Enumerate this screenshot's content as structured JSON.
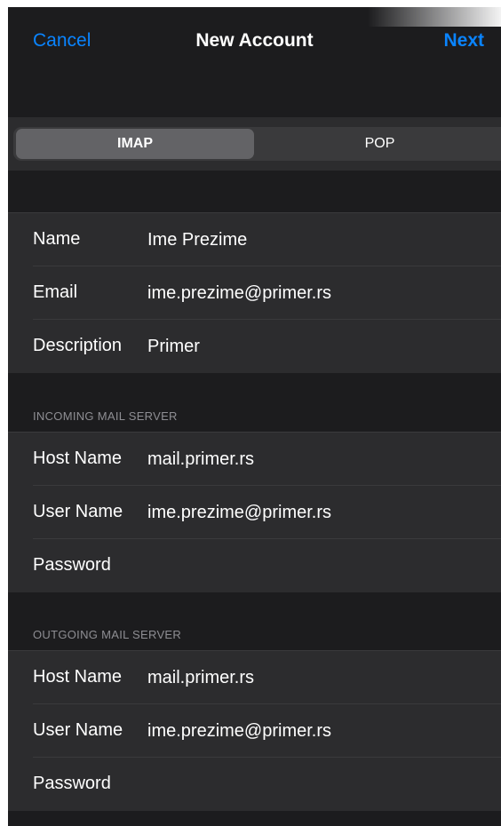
{
  "nav": {
    "cancel": "Cancel",
    "title": "New Account",
    "next": "Next"
  },
  "segmented": {
    "options": [
      "IMAP",
      "POP"
    ],
    "selected": "IMAP"
  },
  "account": {
    "name_label": "Name",
    "name_value": "Ime Prezime",
    "email_label": "Email",
    "email_value": "ime.prezime@primer.rs",
    "description_label": "Description",
    "description_value": "Primer"
  },
  "incoming": {
    "header": "INCOMING MAIL SERVER",
    "host_label": "Host Name",
    "host_value": "mail.primer.rs",
    "user_label": "User Name",
    "user_value": "ime.prezime@primer.rs",
    "password_label": "Password",
    "password_value": ""
  },
  "outgoing": {
    "header": "OUTGOING MAIL SERVER",
    "host_label": "Host Name",
    "host_value": "mail.primer.rs",
    "user_label": "User Name",
    "user_value": "ime.prezime@primer.rs",
    "password_label": "Password",
    "password_value": ""
  },
  "colors": {
    "accent": "#0a84ff",
    "background": "#1c1c1e",
    "cell": "#2c2c2e",
    "secondary_text": "#8e8e93"
  }
}
